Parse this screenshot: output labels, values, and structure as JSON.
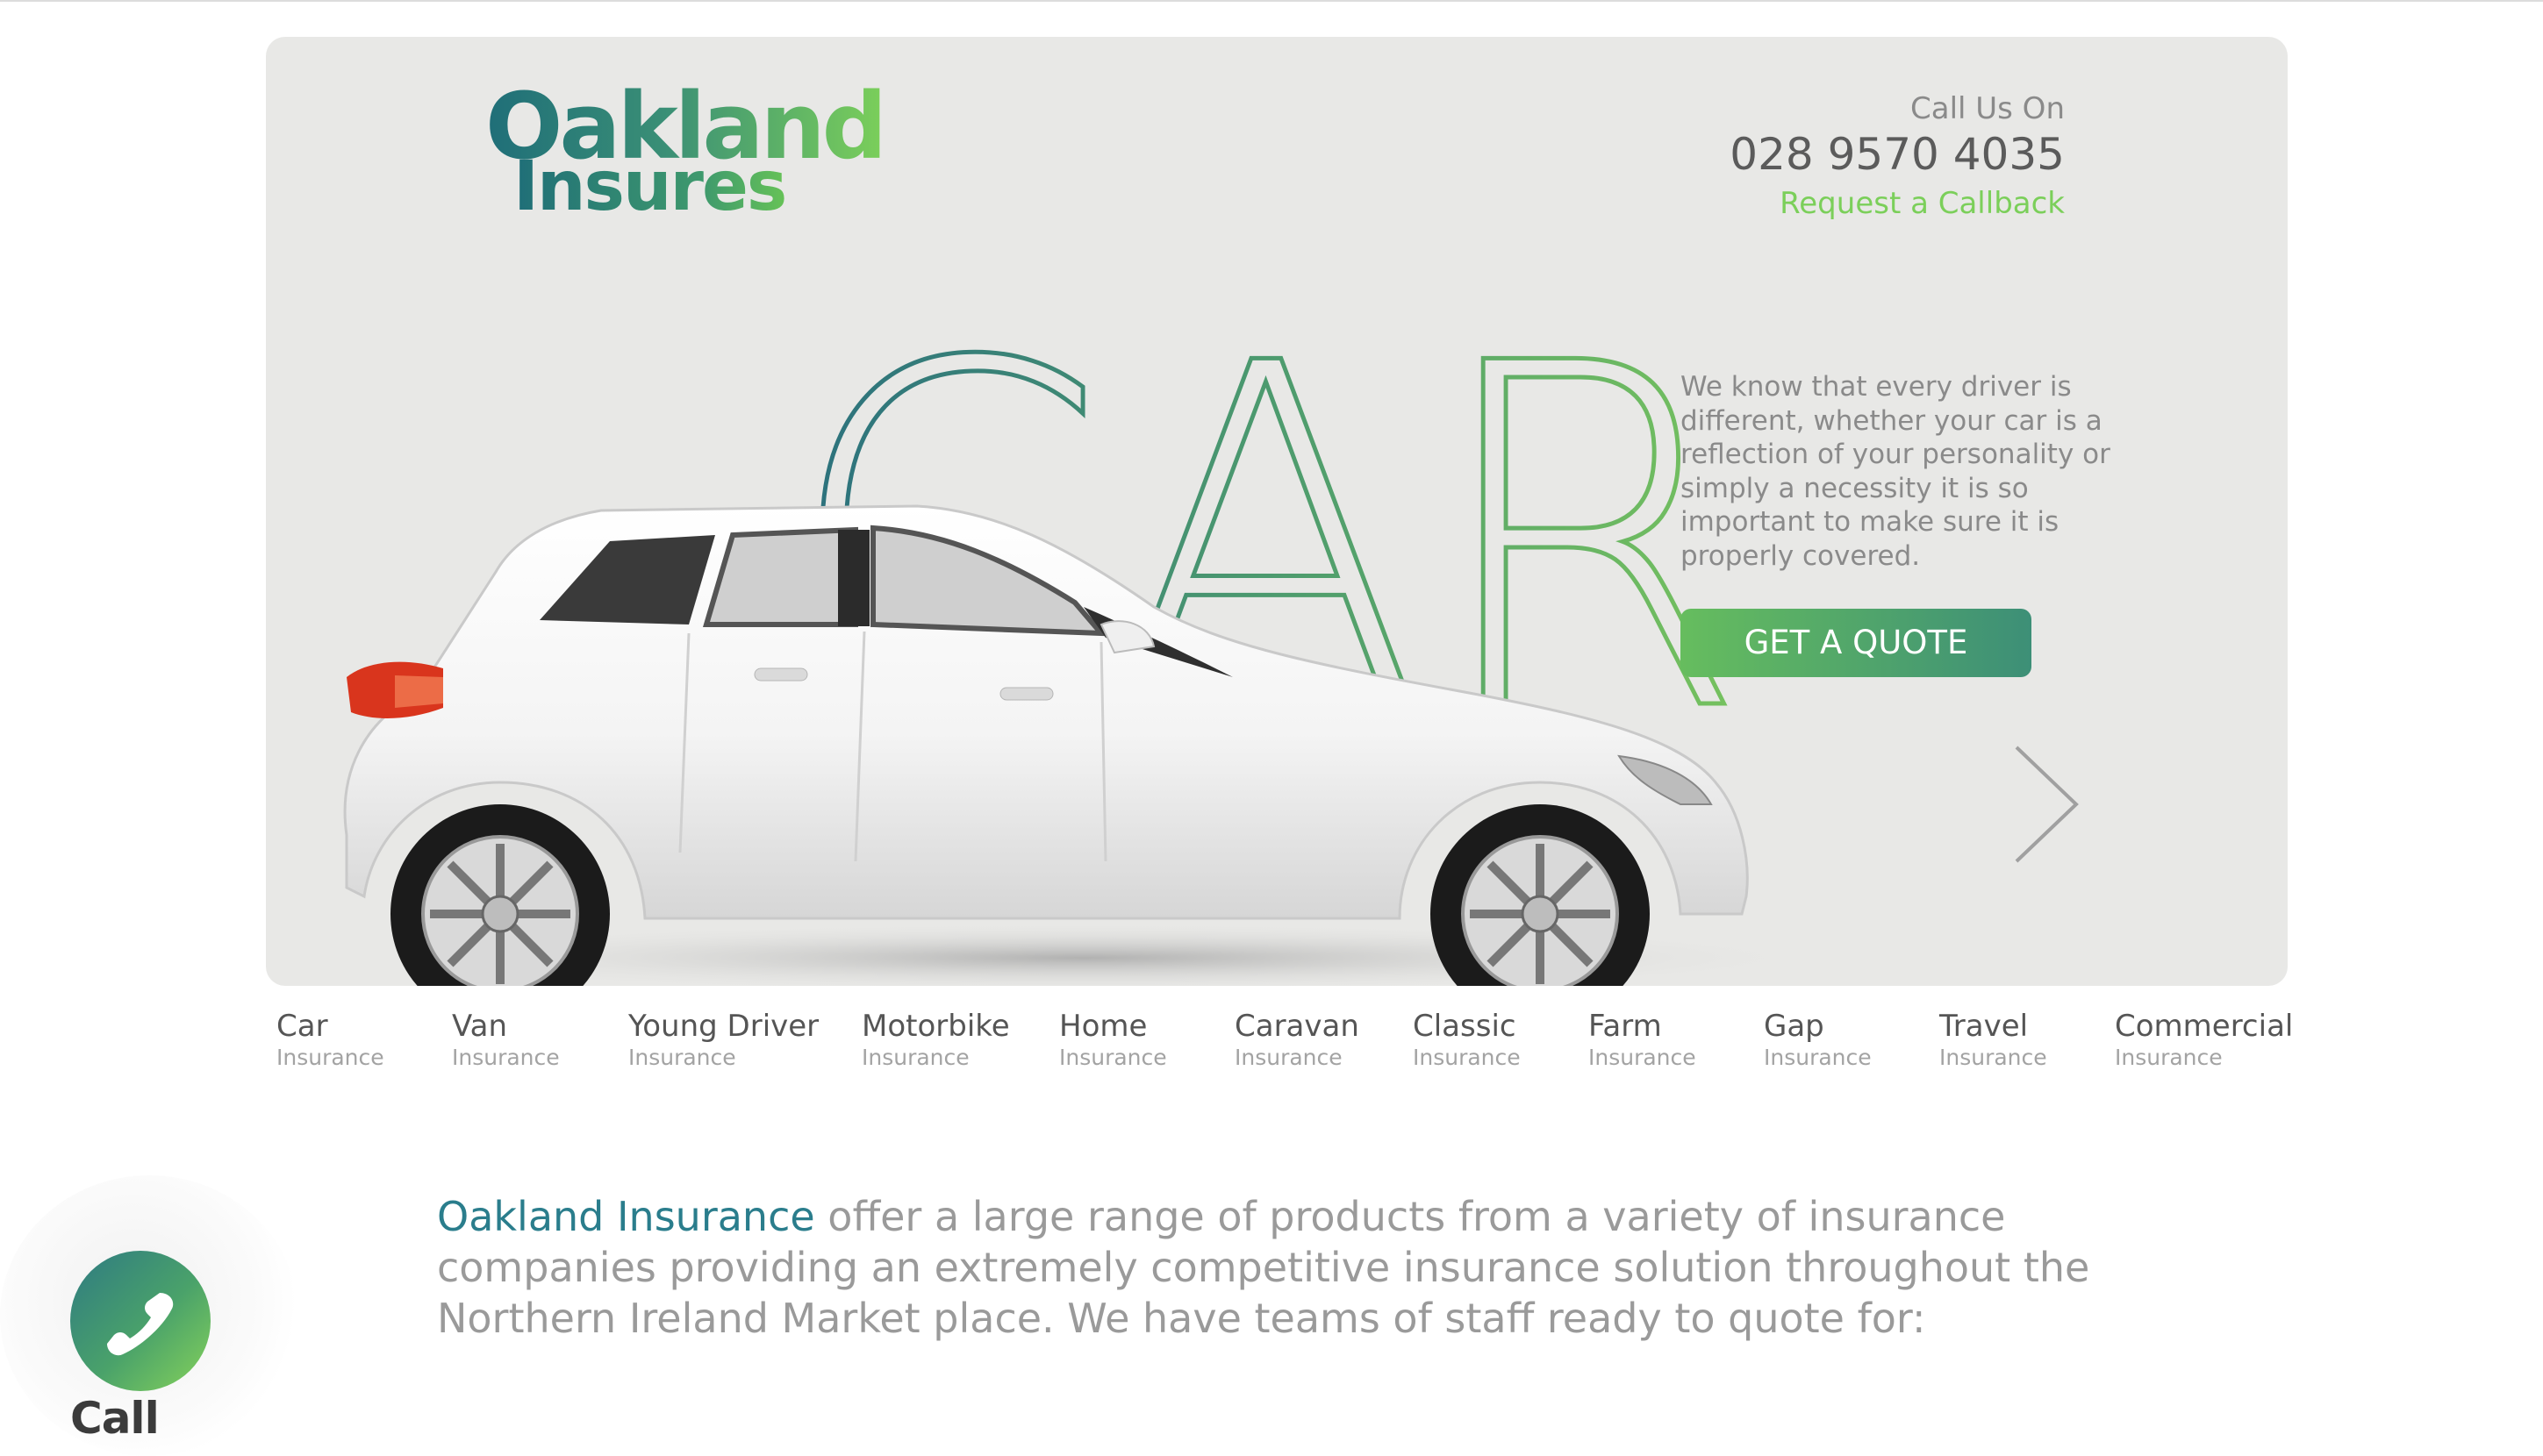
{
  "header": {
    "logo": {
      "line1": "Oakland",
      "line2": "Insures"
    },
    "call_label": "Call Us On",
    "phone": "028 9570 4035",
    "callback_link": "Request a Callback"
  },
  "hero": {
    "big_word": "CAR",
    "description": "We know that every driver is different, whether your car is a reflection of your personality or simply a necessity it is so important to make sure it is properly covered.",
    "quote_button": "GET A QUOTE",
    "next_icon": "chevron-right-icon"
  },
  "products": [
    {
      "title": "Car",
      "sub": "Insurance"
    },
    {
      "title": "Van",
      "sub": "Insurance"
    },
    {
      "title": "Young Driver",
      "sub": "Insurance"
    },
    {
      "title": "Motorbike",
      "sub": "Insurance"
    },
    {
      "title": "Home",
      "sub": "Insurance"
    },
    {
      "title": "Caravan",
      "sub": "Insurance"
    },
    {
      "title": "Classic",
      "sub": "Insurance"
    },
    {
      "title": "Farm",
      "sub": "Insurance"
    },
    {
      "title": "Gap",
      "sub": "Insurance"
    },
    {
      "title": "Travel",
      "sub": "Insurance"
    },
    {
      "title": "Commercial",
      "sub": "Insurance"
    }
  ],
  "intro": {
    "brand": "Oakland Insurance",
    "text": " offer a large range of products from a variety of insurance companies providing an extremely competitive insurance solution throughout the Northern Ireland Market place. We have teams of staff ready to quote for:"
  },
  "floating_call": {
    "label": "Call",
    "icon": "phone-icon"
  },
  "colors": {
    "accent_green": "#7bcf5a",
    "brand_teal": "#2a7d8c",
    "hero_bg": "#e8e8e6"
  }
}
